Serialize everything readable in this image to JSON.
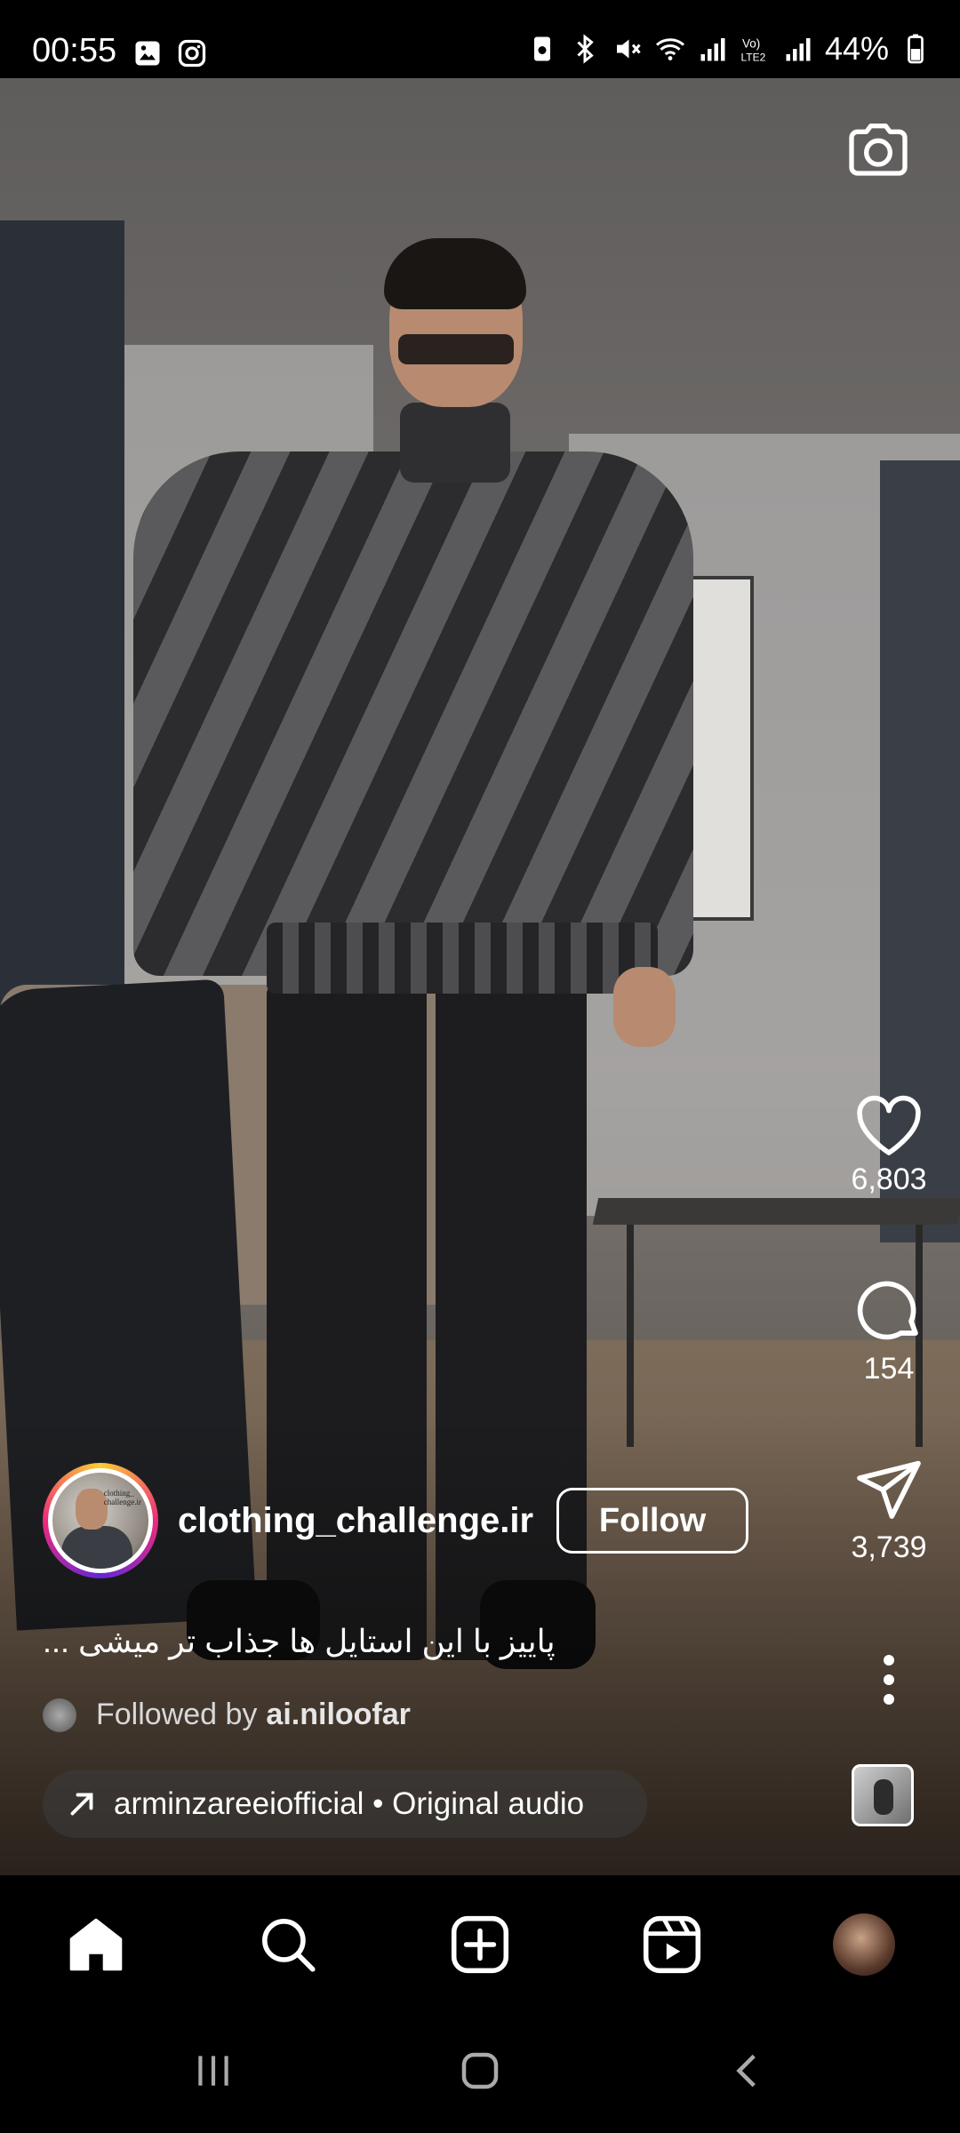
{
  "status_bar": {
    "time": "00:55",
    "battery_percent": "44%",
    "icons_left": [
      "gallery-icon",
      "instagram-icon"
    ],
    "icons_right": [
      "battery-saver-icon",
      "bluetooth-icon",
      "mute-icon",
      "wifi-icon",
      "signal-icon",
      "volte-icon",
      "signal-icon",
      "battery-icon"
    ],
    "volte_label": "Vo)\nLTE2"
  },
  "reel": {
    "camera_icon": "camera-icon",
    "likes": "6,803",
    "comments": "154",
    "shares": "3,739",
    "author": {
      "username": "clothing_challenge.ir",
      "avatar_tag": "clothing_\nchallenge.ir",
      "follow_label": "Follow"
    },
    "caption": "پاییز با این استایل ها جذاب تر میشی ...",
    "followed_by_prefix": "Followed by",
    "followed_by_user": "ai.niloofar",
    "audio_label": "arminzareeiofficial • Original audio"
  },
  "bottom_nav": {
    "items": [
      "home-icon",
      "search-icon",
      "create-icon",
      "reels-icon",
      "profile-avatar"
    ]
  },
  "system_nav": {
    "items": [
      "recent-apps-icon",
      "home-button-icon",
      "back-icon"
    ]
  },
  "colors": {
    "background": "#000000",
    "text": "#ffffff",
    "story_ring_start": "#f9ce34",
    "story_ring_mid": "#ee2a7b",
    "story_ring_end": "#6228d7"
  }
}
